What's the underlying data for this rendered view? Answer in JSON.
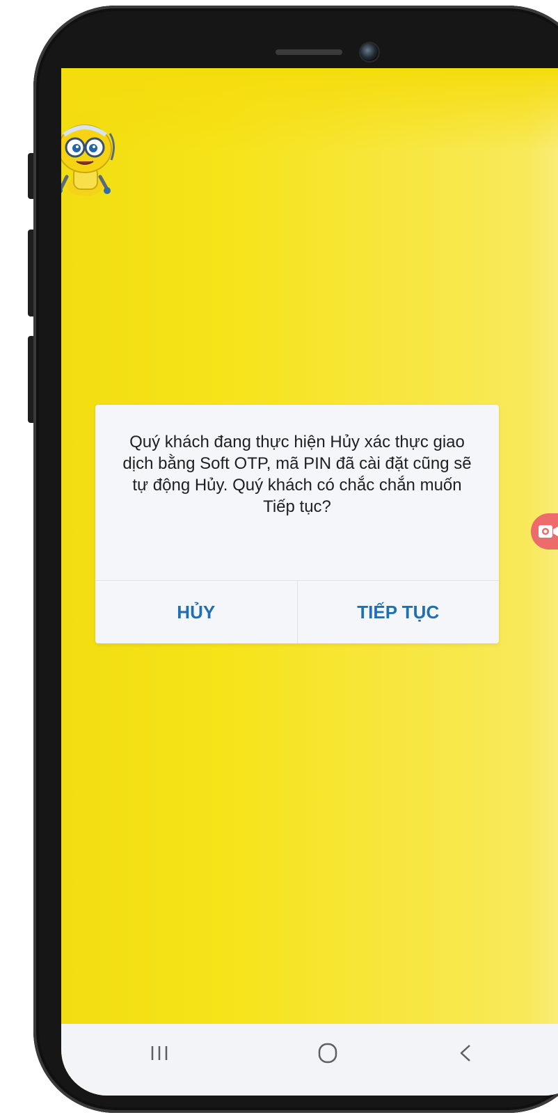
{
  "dialog": {
    "message": "Quý khách đang thực hiện Hủy xác thực giao dịch bằng Soft OTP, mã PIN đã cài đặt cũng sẽ tự động Hủy. Quý khách có chắc chắn muốn Tiếp tục?",
    "cancel_label": "HỦY",
    "continue_label": "TIẾP TỤC"
  },
  "icons": {
    "mascot": "robot-mascot-icon",
    "record": "video-camera-icon",
    "nav_recent": "recent-apps-icon",
    "nav_home": "home-icon",
    "nav_back": "back-icon"
  },
  "colors": {
    "screen_background": "#f6e318",
    "dialog_background": "#f4f6f9",
    "dialog_button_text": "#1f6fb3",
    "record_button": "#ee6b6b",
    "nav_bar": "#f3f4f7"
  }
}
